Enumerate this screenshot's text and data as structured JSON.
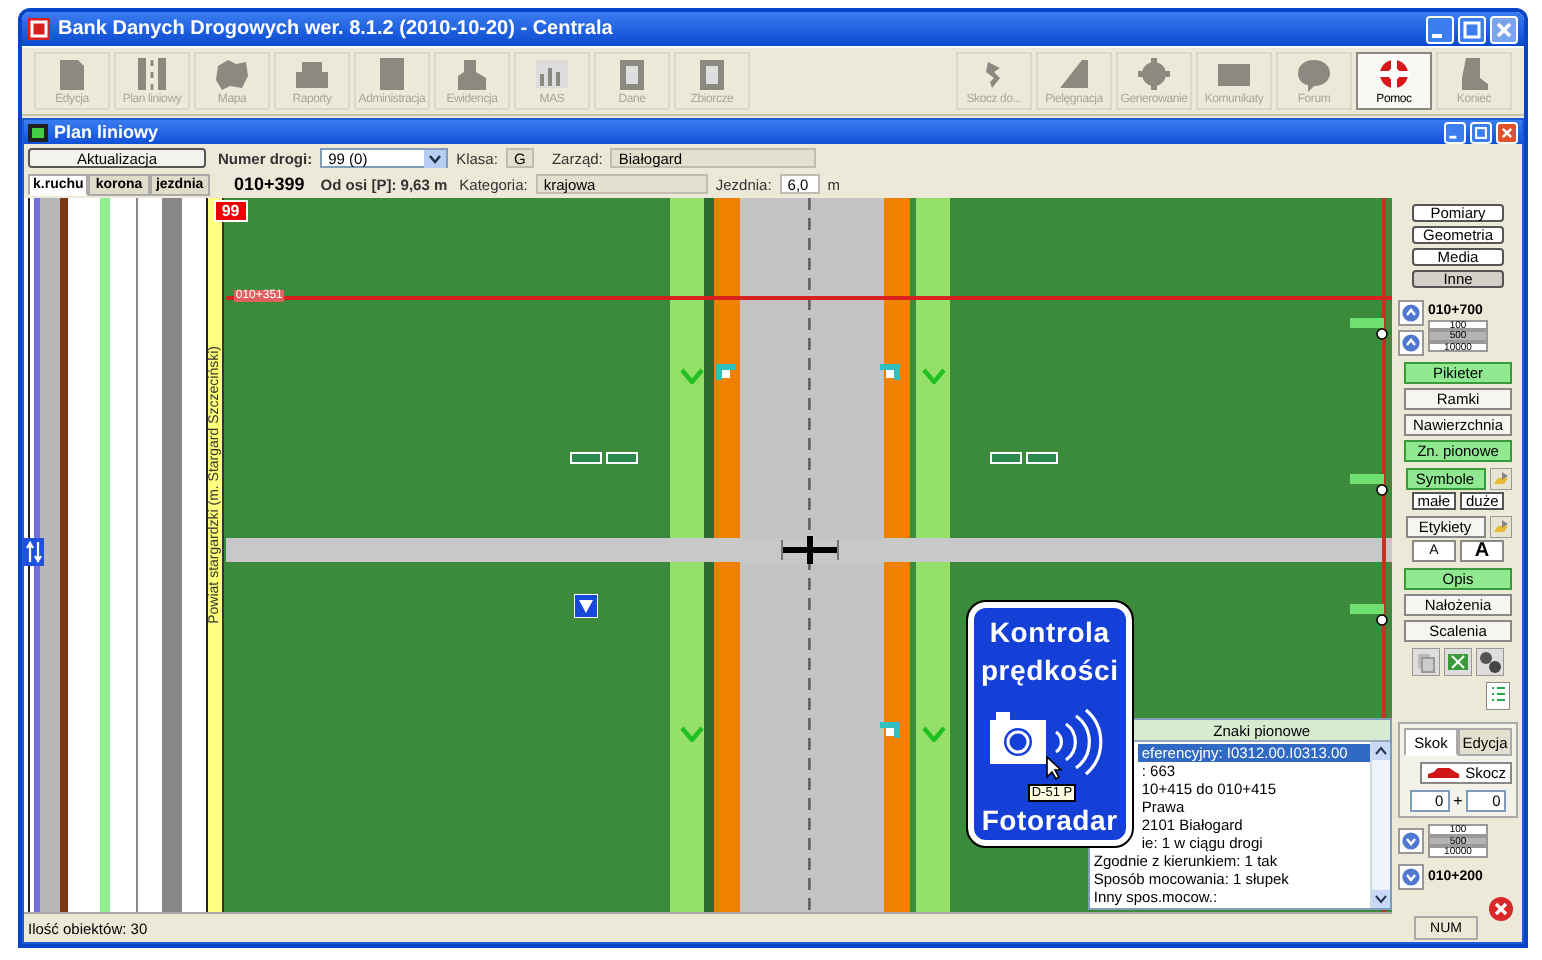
{
  "app": {
    "title": "Bank Danych Drogowych wer. 8.1.2 (2010-10-20) - Centrala"
  },
  "toolbar": {
    "left": [
      {
        "label": "Edycja",
        "disabled": true
      },
      {
        "label": "Plan liniowy",
        "disabled": true
      },
      {
        "label": "Mapa",
        "disabled": true
      },
      {
        "label": "Raporty",
        "disabled": true
      },
      {
        "label": "Administracja",
        "disabled": true
      },
      {
        "label": "Ewidencja",
        "disabled": true
      },
      {
        "label": "MAS",
        "disabled": true
      },
      {
        "label": "Dane",
        "disabled": true
      },
      {
        "label": "Zbiorcze",
        "disabled": true
      }
    ],
    "right": [
      {
        "label": "Skocz do...",
        "disabled": true
      },
      {
        "label": "Pielęgnacja",
        "disabled": true
      },
      {
        "label": "Generowanie",
        "disabled": true
      },
      {
        "label": "Komunikaty",
        "disabled": true
      },
      {
        "label": "Forum",
        "disabled": true
      },
      {
        "label": "Pomoc",
        "disabled": false
      },
      {
        "label": "Koniec",
        "disabled": true
      }
    ]
  },
  "child_window": {
    "title": "Plan liniowy"
  },
  "header": {
    "update_button": "Aktualizacja",
    "road_number_label": "Numer drogi:",
    "road_number": "99 (0)",
    "class_label": "Klasa:",
    "class": "G",
    "manager_label": "Zarząd:",
    "manager": "Białogard",
    "lane_tabs": [
      {
        "label": "k.ruchu",
        "selected": true
      },
      {
        "label": "korona",
        "selected": false
      },
      {
        "label": "jezdnia",
        "selected": false
      }
    ],
    "chainage": "010+399",
    "offset": "Od osi [P]: 9,63 m",
    "category_label": "Kategoria:",
    "category": "krajowa",
    "carriageway_label": "Jezdnia:",
    "carriageway": "6,0",
    "carriageway_unit": "m"
  },
  "map": {
    "road_tag": "99",
    "chainage_marker": "010+351",
    "district": "Powiat stargardzki (m. Stargard Szczeciński)",
    "sign": {
      "line_1": "Kontrola",
      "line_2": "prędkości",
      "line_3": "Fotoradar",
      "tooltip": "D-51 P"
    },
    "info_panel": {
      "title": "Znaki pionowe",
      "lines": [
        {
          "text": "eferencyjny: I0312.00.I0313.00",
          "selected": true
        },
        {
          "text": ": 663",
          "selected": false
        },
        {
          "text": "10+415 do 010+415",
          "selected": false
        },
        {
          "text": "Prawa",
          "selected": false
        },
        {
          "text": "2101 Białogard",
          "selected": false
        },
        {
          "text": "ie: 1 w ciągu drogi",
          "selected": false
        },
        {
          "text": "Zgodnie z kierunkiem: 1 tak",
          "selected": false
        },
        {
          "text": "Sposób mocowania: 1 słupek",
          "selected": false
        },
        {
          "text": "Inny spos.mocow.:",
          "selected": false
        }
      ]
    }
  },
  "side_panel": {
    "layer_buttons": [
      {
        "label": "Pomiary",
        "selected": false
      },
      {
        "label": "Geometria",
        "selected": false
      },
      {
        "label": "Media",
        "selected": false
      },
      {
        "label": "Inne",
        "selected": true
      }
    ],
    "top_chainage": "010+700",
    "steps_top": [
      {
        "label": "100",
        "selected": false
      },
      {
        "label": "500",
        "selected": true
      },
      {
        "label": "10000",
        "selected": false
      }
    ],
    "toggles": [
      {
        "label": "Pikieter",
        "on": true
      },
      {
        "label": "Ramki",
        "on": false
      },
      {
        "label": "Nawierzchnia",
        "on": false
      },
      {
        "label": "Zn. pionowe",
        "on": true
      }
    ],
    "symbols": {
      "label": "Symbole",
      "on": true
    },
    "size_buttons": [
      "małe",
      "duże"
    ],
    "labels_button": "Etykiety",
    "font_buttons": [
      {
        "label": "A",
        "kind": "plain"
      },
      {
        "label": "A",
        "kind": "bold"
      }
    ],
    "toggles_2": [
      {
        "label": "Opis",
        "on": true
      },
      {
        "label": "Nałożenia",
        "on": false
      },
      {
        "label": "Scalenia",
        "on": false
      }
    ],
    "tabs": [
      {
        "label": "Skok",
        "selected": true
      },
      {
        "label": "Edycja",
        "selected": false
      }
    ],
    "jump_button": "Skocz",
    "jump_from": "0",
    "jump_plus": "+",
    "jump_to": "0",
    "steps_bottom": [
      {
        "label": "100",
        "selected": false
      },
      {
        "label": "500",
        "selected": true
      },
      {
        "label": "10000",
        "selected": false
      }
    ],
    "bottom_chainage": "010+200"
  },
  "status_bar": {
    "text": "Ilość obiektów: 30",
    "num": "NUM"
  }
}
